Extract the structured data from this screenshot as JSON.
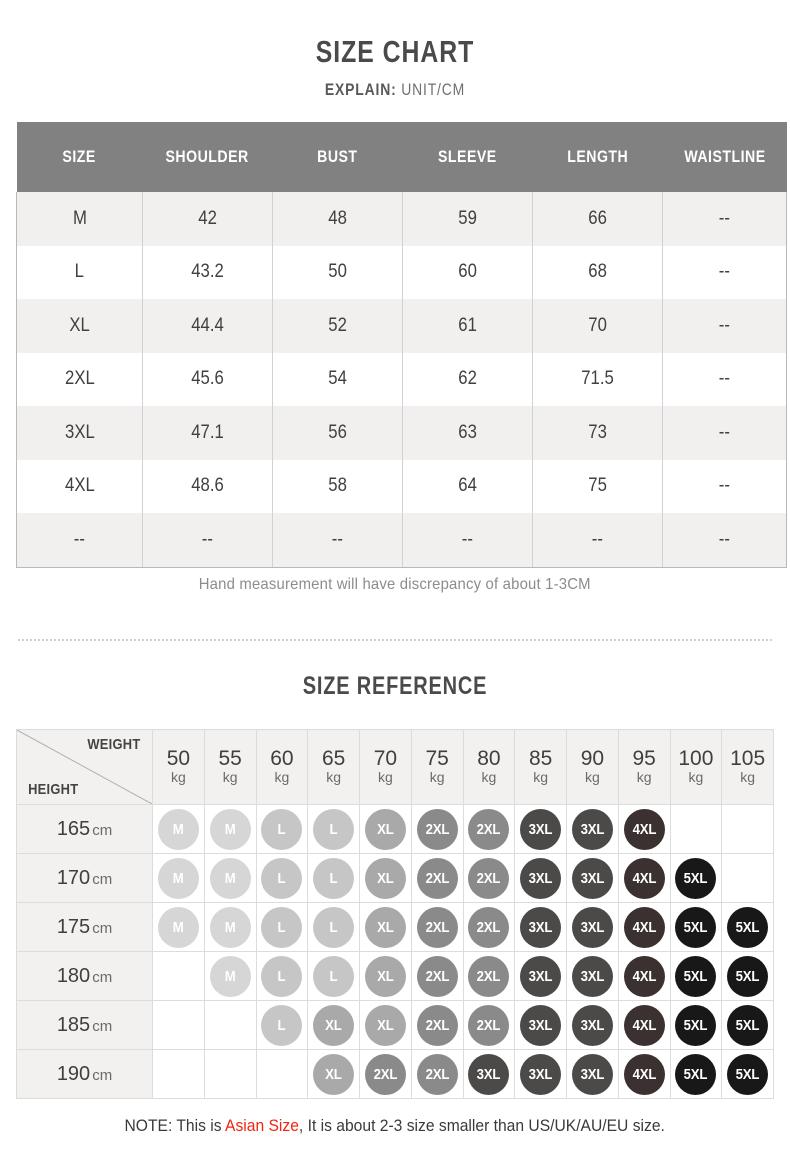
{
  "header": {
    "title": "SIZE CHART",
    "subtitle_key": "EXPLAIN:",
    "subtitle_value": "UNIT/CM"
  },
  "size_chart": {
    "columns": [
      "SIZE",
      "SHOULDER",
      "BUST",
      "SLEEVE",
      "LENGTH",
      "WAISTLINE"
    ],
    "rows": [
      [
        "M",
        "42",
        "48",
        "59",
        "66",
        "--"
      ],
      [
        "L",
        "43.2",
        "50",
        "60",
        "68",
        "--"
      ],
      [
        "XL",
        "44.4",
        "52",
        "61",
        "70",
        "--"
      ],
      [
        "2XL",
        "45.6",
        "54",
        "62",
        "71.5",
        "--"
      ],
      [
        "3XL",
        "47.1",
        "56",
        "63",
        "73",
        "--"
      ],
      [
        "4XL",
        "48.6",
        "58",
        "64",
        "75",
        "--"
      ],
      [
        "--",
        "--",
        "--",
        "--",
        "--",
        "--"
      ]
    ],
    "note": "Hand measurement will have discrepancy of about 1-3CM"
  },
  "size_reference": {
    "title": "SIZE REFERENCE",
    "weight_label": "WEIGHT",
    "height_label": "HEIGHT",
    "weight_unit": "kg",
    "height_unit": "cm",
    "weights": [
      "50",
      "55",
      "60",
      "65",
      "70",
      "75",
      "80",
      "85",
      "90",
      "95",
      "100",
      "105"
    ],
    "heights": [
      "165",
      "170",
      "175",
      "180",
      "185",
      "190"
    ],
    "grid": [
      [
        "M",
        "M",
        "L",
        "L",
        "XL",
        "2XL",
        "2XL",
        "3XL",
        "3XL",
        "4XL",
        "",
        ""
      ],
      [
        "M",
        "M",
        "L",
        "L",
        "XL",
        "2XL",
        "2XL",
        "3XL",
        "3XL",
        "4XL",
        "5XL",
        ""
      ],
      [
        "M",
        "M",
        "L",
        "L",
        "XL",
        "2XL",
        "2XL",
        "3XL",
        "3XL",
        "4XL",
        "5XL",
        "5XL"
      ],
      [
        "",
        "M",
        "L",
        "L",
        "XL",
        "2XL",
        "2XL",
        "3XL",
        "3XL",
        "4XL",
        "5XL",
        "5XL"
      ],
      [
        "",
        "",
        "L",
        "XL",
        "XL",
        "2XL",
        "2XL",
        "3XL",
        "3XL",
        "4XL",
        "5XL",
        "5XL"
      ],
      [
        "",
        "",
        "",
        "XL",
        "2XL",
        "2XL",
        "3XL",
        "3XL",
        "3XL",
        "4XL",
        "5XL",
        "5XL"
      ]
    ]
  },
  "footer": {
    "prefix": "NOTE: This is ",
    "highlight": "Asian Size",
    "suffix": ", It is about 2-3 size smaller than US/UK/AU/EU size."
  },
  "colors": {
    "header_band": "#818181",
    "row_alt": "#f1f0ee",
    "highlight_red": "#f0260f",
    "bubble_M": "#d6d6d6",
    "bubble_L": "#c6c6c6",
    "bubble_XL": "#a9a9a9",
    "bubble_2XL": "#8a8a8a",
    "bubble_3XL": "#4c4a49",
    "bubble_4XL": "#3a3130",
    "bubble_5XL": "#181818"
  }
}
